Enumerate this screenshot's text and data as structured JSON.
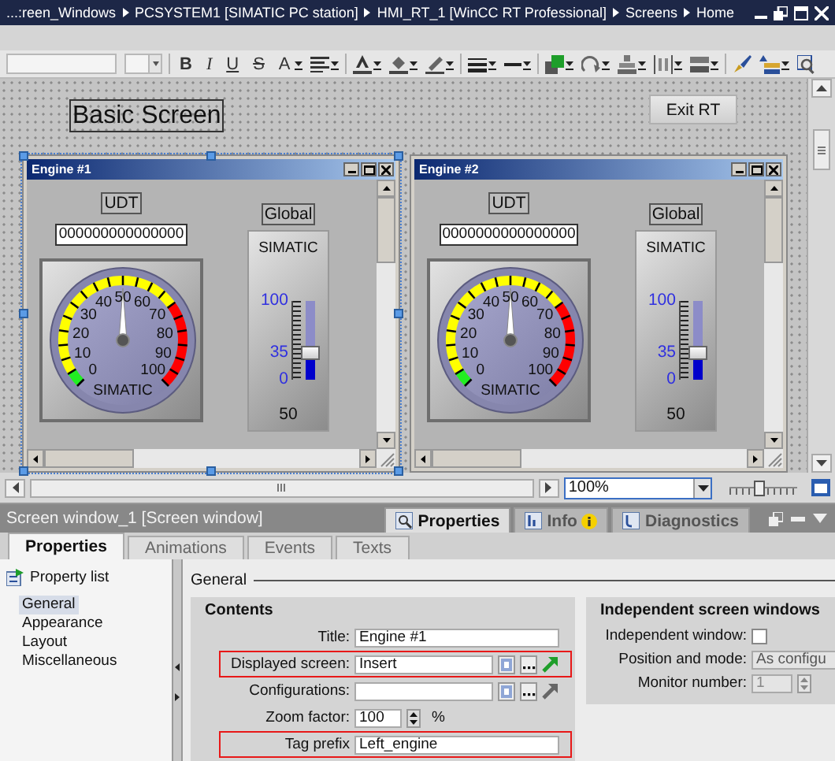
{
  "title_bar": {
    "breadcrumbs": [
      "...:reen_Windows",
      "PCSYSTEM1 [SIMATIC PC station]",
      "HMI_RT_1 [WinCC RT Professional]",
      "Screens",
      "Home"
    ]
  },
  "toolbar": {
    "groups": [
      [
        {
          "kind": "font-box"
        },
        {
          "kind": "size-box"
        }
      ],
      [
        {
          "kind": "text",
          "label": "B"
        },
        {
          "kind": "text",
          "label": "I"
        },
        {
          "kind": "text",
          "label": "U"
        },
        {
          "kind": "text",
          "label": "S"
        },
        {
          "kind": "text",
          "label": "A",
          "dropdown": true
        },
        {
          "kind": "align",
          "dropdown": true
        }
      ],
      [
        {
          "kind": "font-color",
          "dropdown": true
        },
        {
          "kind": "fill-color",
          "dropdown": true
        },
        {
          "kind": "line-color",
          "dropdown": true
        }
      ],
      [
        {
          "kind": "line-width",
          "dropdown": true
        },
        {
          "kind": "line-style",
          "dropdown": true
        }
      ],
      [
        {
          "kind": "layer",
          "dropdown": true
        },
        {
          "kind": "rotate",
          "dropdown": true
        },
        {
          "kind": "stack",
          "dropdown": true
        },
        {
          "kind": "distribute",
          "dropdown": true
        },
        {
          "kind": "same-size",
          "dropdown": true
        }
      ],
      [
        {
          "kind": "brush"
        },
        {
          "kind": "layers-up",
          "dropdown": true
        },
        {
          "kind": "zoom-tool"
        }
      ]
    ]
  },
  "canvas": {
    "title_label": "Basic Screen",
    "exit_button": "Exit RT",
    "windows": [
      {
        "title": "Engine #1",
        "selected": true,
        "udt_label": "UDT",
        "value": "000000000000000",
        "global_label": "Global",
        "gauge": {
          "labels": [
            "40",
            "50",
            "60",
            "30",
            "70",
            "20",
            "80",
            "10",
            "90",
            "0",
            "100"
          ],
          "brand": "SIMATIC",
          "level": 0.5
        },
        "slider": {
          "brand": "SIMATIC",
          "scale": [
            "100",
            "35",
            "0"
          ],
          "level": 0.35,
          "value": "50"
        }
      },
      {
        "title": "Engine #2",
        "selected": false,
        "udt_label": "UDT",
        "value": "0000000000000000",
        "global_label": "Global",
        "gauge": {
          "labels": [
            "40",
            "50",
            "60",
            "30",
            "70",
            "20",
            "80",
            "10",
            "90",
            "0",
            "100"
          ],
          "brand": "SIMATIC",
          "level": 0.5
        },
        "slider": {
          "brand": "SIMATIC",
          "scale": [
            "100",
            "35",
            "0"
          ],
          "level": 0.35,
          "value": "50"
        }
      }
    ]
  },
  "zoom": {
    "value": "100%",
    "level": 0.45
  },
  "inspector": {
    "title": "Screen window_1 [Screen window]",
    "tabs": [
      {
        "label": "Properties",
        "selected": true,
        "kind": "properties"
      },
      {
        "label": "Info",
        "selected": false,
        "kind": "info"
      },
      {
        "label": "Diagnostics",
        "selected": false,
        "kind": "diagnostics"
      }
    ]
  },
  "property_tabs": [
    {
      "label": "Properties",
      "selected": true
    },
    {
      "label": "Animations",
      "selected": false
    },
    {
      "label": "Events",
      "selected": false
    },
    {
      "label": "Texts",
      "selected": false
    }
  ],
  "sidebar": {
    "header": "Property list",
    "items": [
      {
        "label": "General",
        "selected": true
      },
      {
        "label": "Appearance",
        "selected": false
      },
      {
        "label": "Layout",
        "selected": false
      },
      {
        "label": "Miscellaneous",
        "selected": false
      }
    ]
  },
  "section": "General",
  "contents": {
    "title": "Contents",
    "rows": [
      {
        "label": "Title:",
        "kind": "text",
        "value": "Engine #1",
        "highlighted": false
      },
      {
        "label": "Displayed screen:",
        "kind": "browse",
        "value": "Insert",
        "highlighted": true,
        "link_enabled": true
      },
      {
        "label": "Configurations:",
        "kind": "browse",
        "highlighted": false,
        "link_enabled": false
      },
      {
        "label": "Zoom factor:",
        "kind": "spin",
        "value": "100",
        "unit": "%",
        "highlighted": false,
        "disabled": false
      },
      {
        "label": "Tag prefix",
        "kind": "text",
        "value": "Left_engine",
        "highlighted": true
      }
    ]
  },
  "independent": {
    "title": "Independent screen windows",
    "rows": [
      {
        "label": "Independent window:",
        "kind": "checkbox",
        "checked": false
      },
      {
        "label": "Position and mode:",
        "kind": "dropdown",
        "value": "As configu"
      },
      {
        "label": "Monitor number:",
        "kind": "spin",
        "value": "1",
        "disabled": true
      }
    ]
  }
}
